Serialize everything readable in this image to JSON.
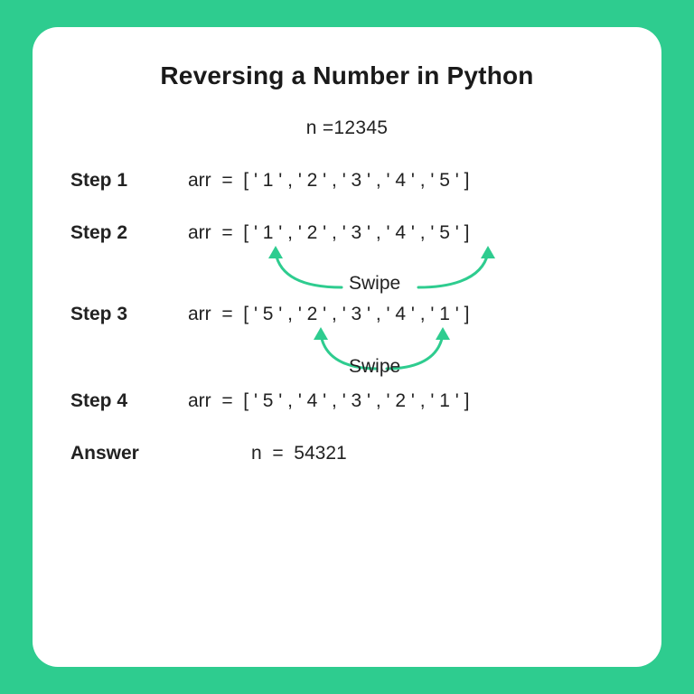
{
  "title": "Reversing a Number in Python",
  "initial": {
    "label": "n  =  ",
    "value": "12345"
  },
  "steps": {
    "s1": {
      "label": "Step 1",
      "var": "arr  =  ",
      "text": "[ ' 1 ' , ' 2 ' , ' 3 ' , ' 4 ' , ' 5 ' ]"
    },
    "s2": {
      "label": "Step 2",
      "var": "arr  =  ",
      "text": "[ ' 1 ' , ' 2 ' , ' 3 ' , ' 4 ' , ' 5 ' ]"
    },
    "s3": {
      "label": "Step 3",
      "var": "arr  =  ",
      "text": "[ ' 5 ' , ' 2 ' , ' 3 ' , ' 4 ' , ' 1 ' ]"
    },
    "s4": {
      "label": "Step 4",
      "var": "arr  =  ",
      "text": "[ ' 5 ' , ' 4 ' , ' 3 ' , ' 2 ' , ' 1 ' ]"
    }
  },
  "swipe_label": "Swipe",
  "answer": {
    "label": "Answer",
    "var": "n  =  ",
    "value": "54321"
  },
  "colors": {
    "accent": "#2ecc8f",
    "text": "#222222",
    "card": "#ffffff"
  }
}
